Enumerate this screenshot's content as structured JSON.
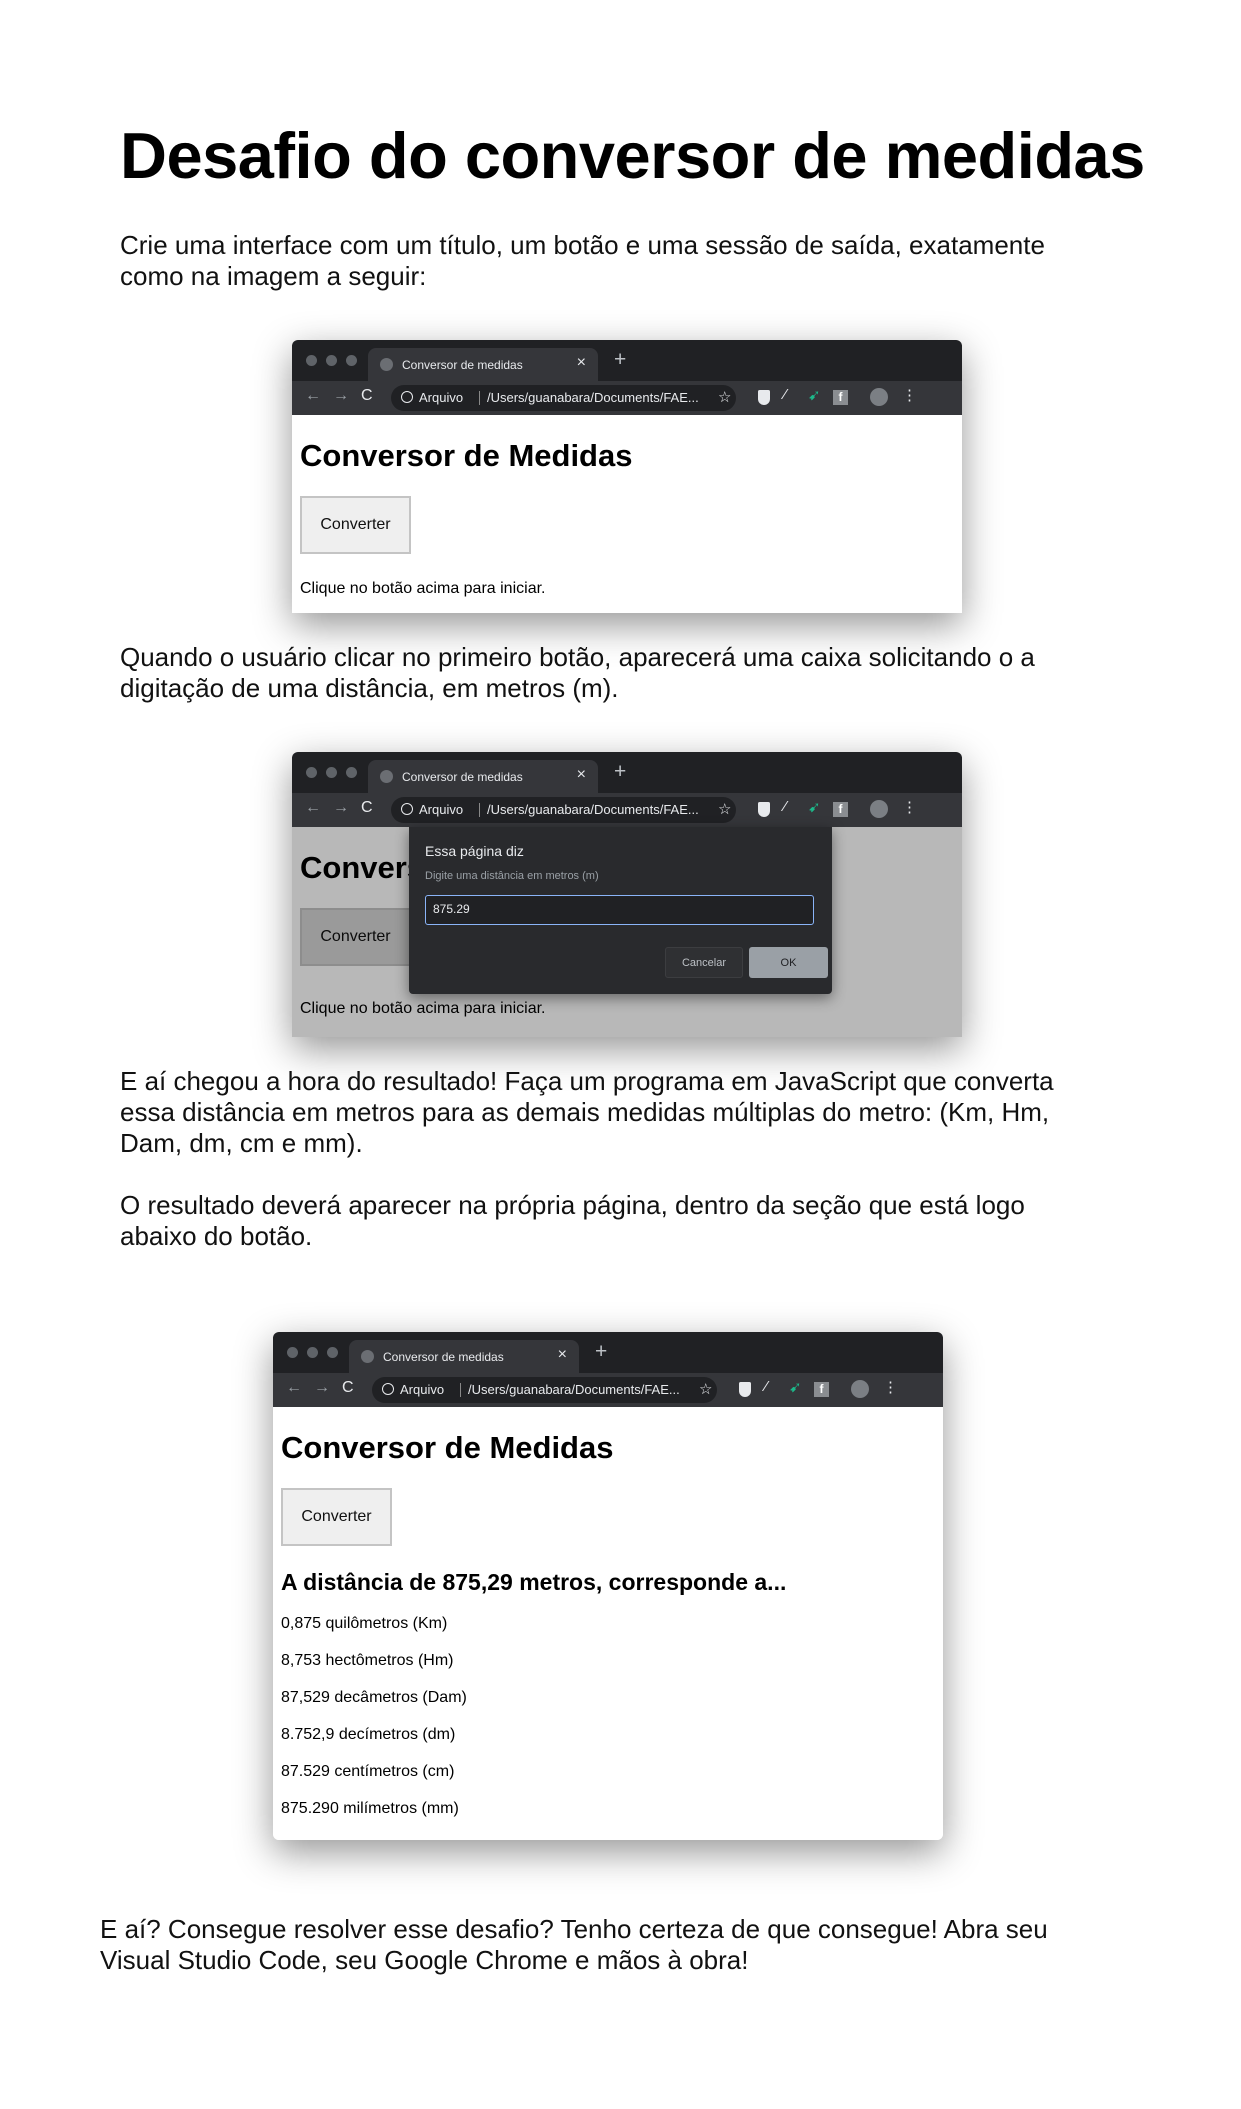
{
  "page": {
    "title": "Desafio do conversor de medidas",
    "intro": [
      "Crie uma interface com um título, um botão e uma sessão de saída, exatamente",
      "como na imagem a seguir:"
    ],
    "step2": [
      "Quando o usuário clicar no primeiro botão, aparecerá uma caixa solicitando o a",
      "digitação de uma distância, em metros (m)."
    ],
    "step3": [
      "E aí chegou a hora do resultado! Faça um programa em JavaScript que converta",
      "essa distância em metros para as demais medidas múltiplas do metro: (Km, Hm,",
      "Dam, dm, cm e mm)."
    ],
    "step4": [
      "O resultado deverá aparecer na própria página, dentro da seção que está logo",
      "abaixo do botão."
    ],
    "closing": [
      "E aí? Consegue resolver esse desafio? Tenho certeza de que consegue! Abra seu",
      "Visual Studio Code, seu Google Chrome e mãos à obra!"
    ]
  },
  "browser": {
    "tab_title": "Conversor de medidas",
    "tab_close": "×",
    "new_tab": "+",
    "back": "←",
    "forward": "→",
    "reload": "C",
    "address_label": "Arquivo",
    "address_url": "/Users/guanabara/Documents/FAE...",
    "star": "☆",
    "ext_f": "f",
    "menu": "⋮",
    "ext_wand": "⁄",
    "ext_bird": "➹"
  },
  "app": {
    "heading": "Conversor de Medidas",
    "button_label": "Converter",
    "initial_output": "Clique no botão acima para iniciar.",
    "result_heading": "A distância de 875,29 metros, corresponde a...",
    "results": [
      "0,875 quilômetros (Km)",
      "8,753 hectômetros (Hm)",
      "87,529 decâmetros (Dam)",
      "8.752,9 decímetros (dm)",
      "87.529 centímetros (cm)",
      "875.290 milímetros (mm)"
    ]
  },
  "dialog": {
    "title": "Essa página diz",
    "message": "Digite uma distância em metros (m)",
    "input_value": "875.29",
    "cancel_label": "Cancelar",
    "ok_label": "OK"
  }
}
